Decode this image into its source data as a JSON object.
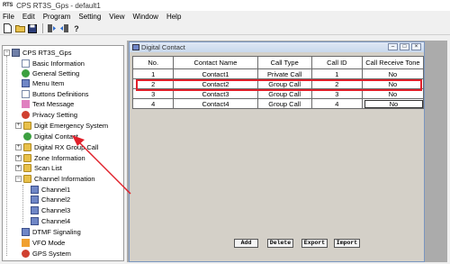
{
  "window": {
    "logo": "RTS",
    "title": "CPS RT3S_Gps - default1"
  },
  "menu": [
    "File",
    "Edit",
    "Program",
    "Setting",
    "View",
    "Window",
    "Help"
  ],
  "toolbar": [
    "new-icon",
    "open-icon",
    "save-icon",
    "read-icon",
    "write-icon",
    "help-icon"
  ],
  "tree": {
    "root": "CPS RT3S_Gps",
    "items": [
      {
        "label": "Basic Information",
        "icon": "info-icon"
      },
      {
        "label": "General Setting",
        "icon": "settings-icon"
      },
      {
        "label": "Menu Item",
        "icon": "menu-icon"
      },
      {
        "label": "Buttons Definitions",
        "icon": "buttons-icon"
      },
      {
        "label": "Text Message",
        "icon": "message-icon"
      },
      {
        "label": "Privacy Setting",
        "icon": "privacy-icon"
      },
      {
        "label": "Digit Emergency System",
        "icon": "folder-icon"
      },
      {
        "label": "Digital Contact",
        "icon": "contact-icon"
      },
      {
        "label": "Digital RX Group Call",
        "icon": "folder-icon"
      },
      {
        "label": "Zone Information",
        "icon": "folder-icon"
      },
      {
        "label": "Scan List",
        "icon": "folder-icon"
      },
      {
        "label": "Channel Information",
        "icon": "folder-icon"
      },
      {
        "label": "Channel1",
        "icon": "channel-icon"
      },
      {
        "label": "Channel2",
        "icon": "channel-icon"
      },
      {
        "label": "Channel3",
        "icon": "channel-icon"
      },
      {
        "label": "Channel4",
        "icon": "channel-icon"
      },
      {
        "label": "DTMF Signaling",
        "icon": "dtmf-icon"
      },
      {
        "label": "VFO Mode",
        "icon": "vfo-icon"
      },
      {
        "label": "GPS System",
        "icon": "gps-icon"
      }
    ]
  },
  "child": {
    "title": "Digital Contact",
    "columns": [
      "No.",
      "Contact Name",
      "Call Type",
      "Call ID",
      "Call Receive Tone"
    ],
    "rows": [
      [
        "1",
        "Contact1",
        "Private Call",
        "1",
        "No"
      ],
      [
        "2",
        "Contact2",
        "Group Call",
        "2",
        "No"
      ],
      [
        "3",
        "Contact3",
        "Group Call",
        "3",
        "No"
      ],
      [
        "4",
        "Contact4",
        "Group Call",
        "4",
        "No"
      ]
    ],
    "buttons": [
      "Add",
      "Delete",
      "Export",
      "Import"
    ]
  },
  "colors": {
    "highlight": "#e0202a",
    "arrow": "#e0202a"
  }
}
